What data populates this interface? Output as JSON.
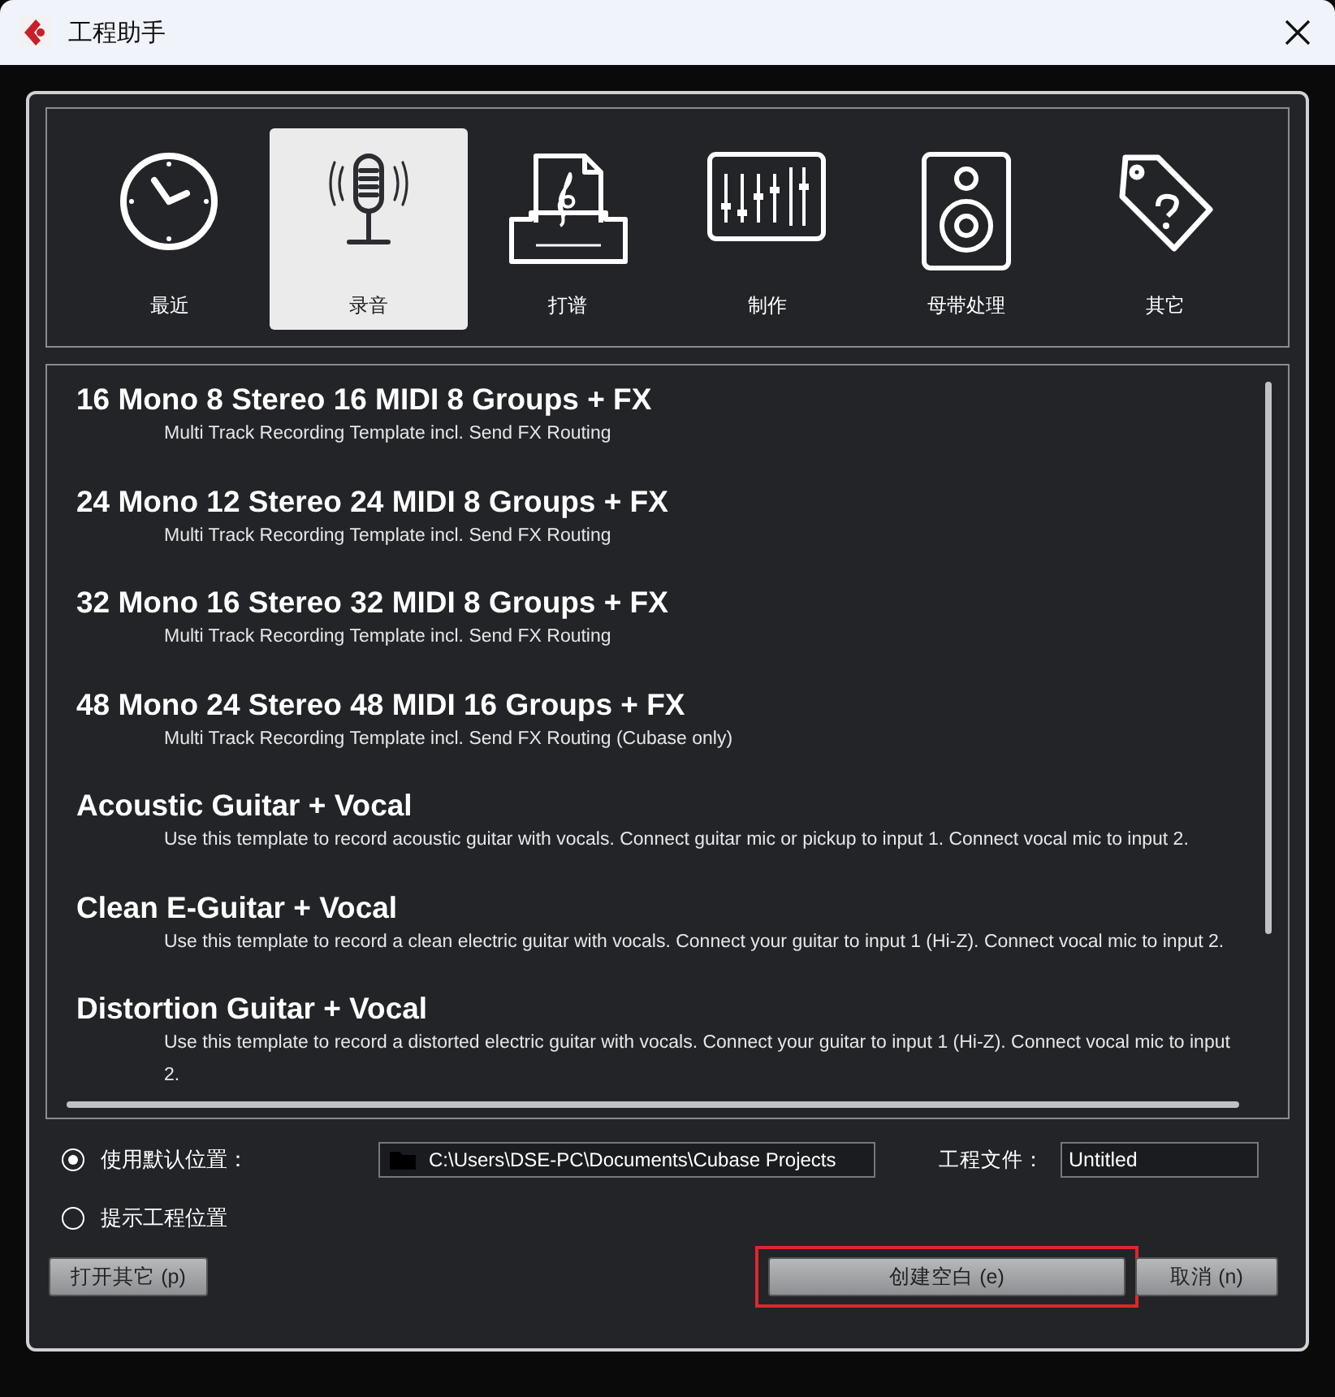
{
  "window": {
    "title": "工程助手"
  },
  "categories": [
    {
      "label": "最近",
      "selected": false
    },
    {
      "label": "录音",
      "selected": true
    },
    {
      "label": "打谱",
      "selected": false
    },
    {
      "label": "制作",
      "selected": false
    },
    {
      "label": "母带处理",
      "selected": false
    },
    {
      "label": "其它",
      "selected": false
    }
  ],
  "templates": [
    {
      "title": "16 Mono 8 Stereo 16 MIDI 8 Groups + FX",
      "description": "Multi Track Recording Template incl. Send FX Routing"
    },
    {
      "title": "24 Mono 12 Stereo 24 MIDI 8 Groups + FX",
      "description": "Multi Track Recording Template incl. Send FX Routing"
    },
    {
      "title": "32 Mono 16 Stereo 32 MIDI 8 Groups + FX",
      "description": "Multi Track Recording Template incl. Send FX Routing"
    },
    {
      "title": "48 Mono 24 Stereo 48 MIDI 16 Groups + FX",
      "description": "Multi Track Recording Template incl. Send FX Routing (Cubase only)"
    },
    {
      "title": "Acoustic Guitar + Vocal",
      "description": "Use this template to record acoustic guitar with vocals. Connect guitar mic or pickup to input 1. Connect vocal mic to input 2."
    },
    {
      "title": "Clean E-Guitar + Vocal",
      "description": "Use this template to record a clean electric guitar with vocals. Connect your guitar to input 1 (Hi-Z). Connect vocal mic to input 2."
    },
    {
      "title": "Distortion Guitar + Vocal",
      "description": "Use this template to record a distorted electric guitar with vocals. Connect your guitar to input 1 (Hi-Z). Connect vocal mic to input 2."
    }
  ],
  "location_options": [
    {
      "label": "使用默认位置：",
      "selected": true
    },
    {
      "label": "提示工程位置",
      "selected": false
    }
  ],
  "location_path": "C:\\Users\\DSE-PC\\Documents\\Cubase Projects",
  "project_file": {
    "label": "工程文件：",
    "value": "Untitled"
  },
  "buttons": [
    {
      "label": "打开其它 (p)",
      "highlighted": false
    },
    {
      "label": "创建空白 (e)",
      "highlighted": true
    },
    {
      "label": "取消 (n)",
      "highlighted": false
    }
  ]
}
